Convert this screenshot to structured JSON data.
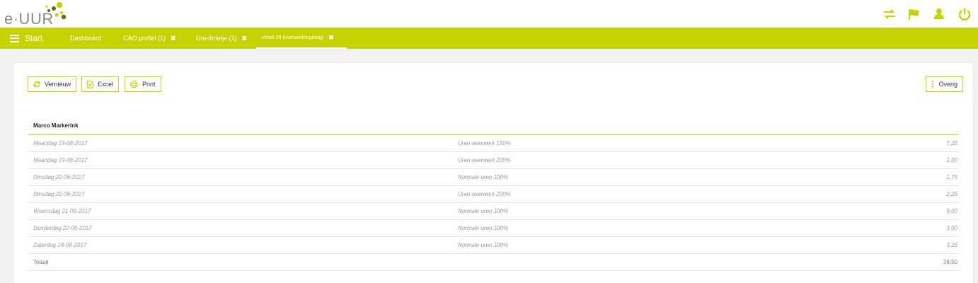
{
  "app": {
    "logo_text": "e·UUR"
  },
  "header": {
    "icons": [
      {
        "name": "switch-icon",
        "color": "#c7d300"
      },
      {
        "name": "flag-icon",
        "color": "#c7d300"
      },
      {
        "name": "user-icon",
        "color": "#c7d300"
      },
      {
        "name": "power-icon",
        "color": "#c7d300"
      }
    ]
  },
  "nav": {
    "start_label": "Start",
    "tabs": [
      {
        "label": "Dashboard",
        "closable": false,
        "active": false
      },
      {
        "label": "CAO profiel (1)",
        "closable": true,
        "active": false
      },
      {
        "label": "Urenbriefje (1)",
        "closable": true,
        "active": false
      },
      {
        "label": "Week 25 (overwerkregeling)",
        "closable": true,
        "active": true
      }
    ],
    "close_glyph": "✖"
  },
  "toolbar": {
    "refresh_label": "Vernieuw",
    "excel_label": "Excel",
    "print_label": "Print",
    "other_label": "Overig"
  },
  "report": {
    "person": "Marco Markerink",
    "rows": [
      {
        "date": "Maandag 19-06-2017",
        "type": "Uren overwerk 150%",
        "value": "7,25"
      },
      {
        "date": "Maandag 19-06-2017",
        "type": "Uren overwerk 200%",
        "value": "1,00"
      },
      {
        "date": "Dinsdag 20-06-2017",
        "type": "Normale uren 100%",
        "value": "1,75"
      },
      {
        "date": "Dinsdag 20-06-2017",
        "type": "Uren overwerk 200%",
        "value": "2,25"
      },
      {
        "date": "Woensdag 21-06-2017",
        "type": "Normale uren 100%",
        "value": "8,00"
      },
      {
        "date": "Donderdag 22-06-2017",
        "type": "Normale uren 100%",
        "value": "3,00"
      },
      {
        "date": "Zaterdag 24-06-2017",
        "type": "Normale uren 100%",
        "value": "3,25"
      }
    ],
    "total_label": "Totaal",
    "total_value": "26,50"
  },
  "colors": {
    "accent": "#c7d300",
    "logo_dot_dark": "#5a6a16",
    "logo_dot_light": "#c7d300"
  }
}
